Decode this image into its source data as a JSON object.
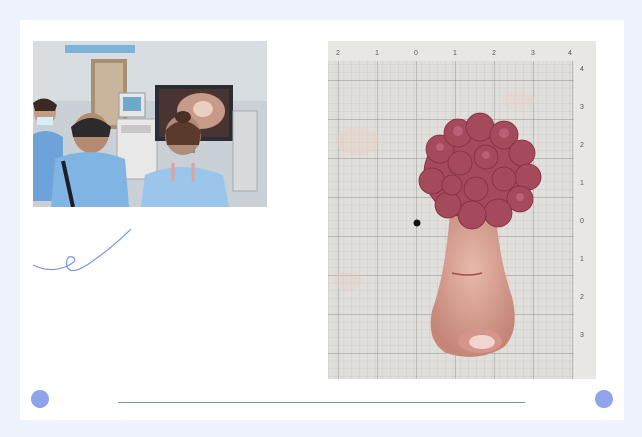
{
  "images": {
    "left_photo": {
      "subject": "surgical team viewing an endoscopy monitor"
    },
    "right_photo": {
      "subject": "excised polyp specimen on a measurement grid"
    }
  },
  "ruler": {
    "top_ticks": [
      "2",
      "1",
      "0",
      "1",
      "2",
      "3",
      "4"
    ],
    "side_ticks": [
      "4",
      "3",
      "2",
      "1",
      "0",
      "1",
      "2",
      "3"
    ]
  },
  "colors": {
    "background": "#eef2fc",
    "accent_dot": "#8fa4ea",
    "divider": "#6fa08a",
    "squiggle": "#7b95dc"
  }
}
